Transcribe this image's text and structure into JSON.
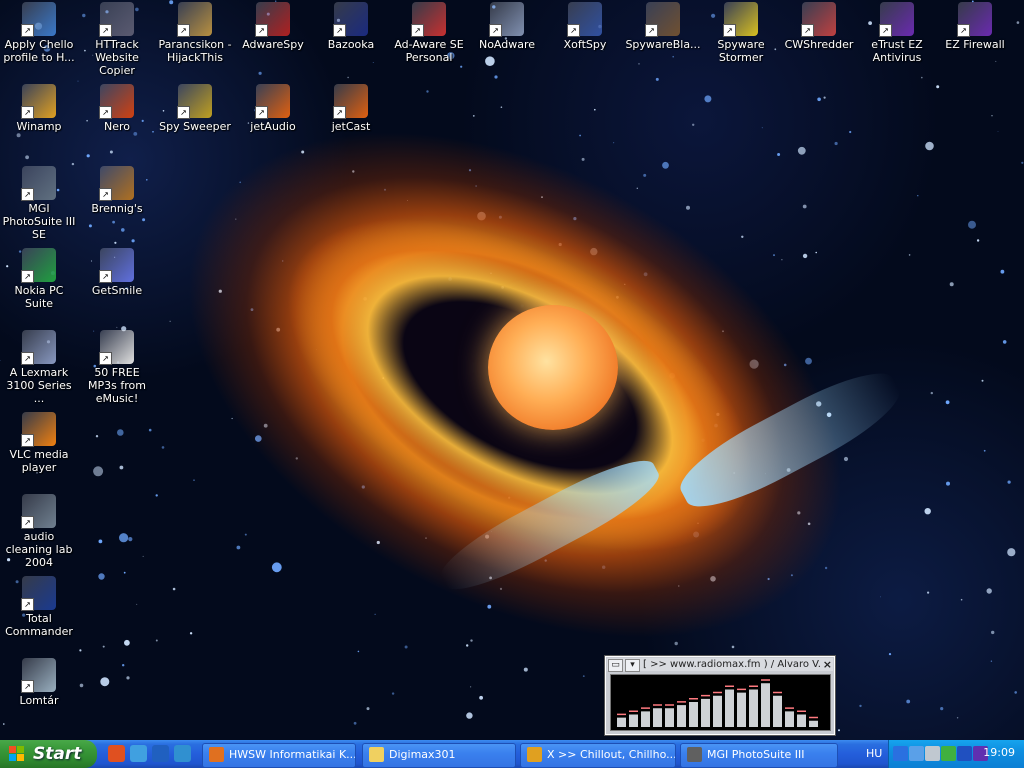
{
  "desktop": {
    "icons": [
      {
        "label": "Apply Chello profile to H...",
        "icon": "chello-profile-icon",
        "color": "#3a78c8"
      },
      {
        "label": "HTTrack Website Copier",
        "icon": "httrack-icon",
        "color": "#5a5a70"
      },
      {
        "label": "Parancsikon - HijackThis",
        "icon": "hijackthis-icon",
        "color": "#b89040"
      },
      {
        "label": "AdwareSpy",
        "icon": "adwarespy-icon",
        "color": "#b02020"
      },
      {
        "label": "Bazooka",
        "icon": "bazooka-icon",
        "color": "#1a2a80"
      },
      {
        "label": "Ad-Aware SE Personal",
        "icon": "adaware-icon",
        "color": "#c83030"
      },
      {
        "label": "NoAdware",
        "icon": "noadware-icon",
        "color": "#8090b0"
      },
      {
        "label": "XoftSpy",
        "icon": "xoftspy-icon",
        "color": "#3050a0"
      },
      {
        "label": "SpywareBla...",
        "icon": "spywareblaster-icon",
        "color": "#705030"
      },
      {
        "label": "Spyware Stormer",
        "icon": "spyware-stormer-icon",
        "color": "#d8c020"
      },
      {
        "label": "CWShredder",
        "icon": "cwshredder-icon",
        "color": "#c04040"
      },
      {
        "label": "eTrust EZ Antivirus",
        "icon": "etrust-ez-antivirus-icon",
        "color": "#6a2ab0"
      },
      {
        "label": "EZ Firewall",
        "icon": "ez-firewall-icon",
        "color": "#6a2ab0"
      },
      {
        "label": "Winamp",
        "icon": "winamp-icon",
        "color": "#e0a020"
      },
      {
        "label": "Nero",
        "icon": "nero-icon",
        "color": "#d04010"
      },
      {
        "label": "Spy Sweeper",
        "icon": "spy-sweeper-icon",
        "color": "#c0a020"
      },
      {
        "label": "jetAudio",
        "icon": "jetaudio-icon",
        "color": "#e06010"
      },
      {
        "label": "jetCast",
        "icon": "jetcast-icon",
        "color": "#e06010"
      },
      {
        "label": "MGI PhotoSuite III SE",
        "icon": "photosuite-icon",
        "color": "#607080"
      },
      {
        "label": "Brennig's",
        "icon": "brennigs-icon",
        "color": "#b07020"
      },
      {
        "label": "Nokia PC Suite",
        "icon": "nokia-pc-suite-icon",
        "color": "#20a040"
      },
      {
        "label": "GetSmile",
        "icon": "getsmile-icon",
        "color": "#6070e0"
      },
      {
        "label": "A Lexmark 3100 Series ...",
        "icon": "lexmark-icon",
        "color": "#8898c0"
      },
      {
        "label": "50 FREE MP3s from eMusic!",
        "icon": "emusic-icon",
        "color": "#e0e0e0"
      },
      {
        "label": "VLC media player",
        "icon": "vlc-cone-icon",
        "color": "#f08010"
      },
      {
        "label": "audio cleaning lab 2004",
        "icon": "audio-cleaning-lab-icon",
        "color": "#708090"
      },
      {
        "label": "Total Commander",
        "icon": "floppy-disk-icon",
        "color": "#1a3a90"
      },
      {
        "label": "Lomtár",
        "icon": "recycle-bin-icon",
        "color": "#9ab0c0"
      }
    ]
  },
  "winamp": {
    "title": "[ >> www.radiomax.fm ) / Alvaro V...",
    "close": "×",
    "spectrum": [
      3,
      4,
      5,
      6,
      6,
      7,
      8,
      9,
      10,
      12,
      11,
      12,
      14,
      10,
      5,
      4,
      2
    ]
  },
  "taskbar": {
    "start_label": "Start",
    "quick_launch": [
      "media-player-icon",
      "network-icon",
      "internet-explorer-icon",
      "desktop-icon"
    ],
    "tasks": [
      {
        "label": "HWSW Informatikai K...",
        "icon": "firefox-icon",
        "color": "#e07020"
      },
      {
        "label": "Digimax301",
        "icon": "folder-icon",
        "color": "#f0d060"
      },
      {
        "label": "X >> Chillout, Chillho...",
        "icon": "winamp-icon",
        "color": "#e0a020"
      },
      {
        "label": "MGI PhotoSuite III",
        "icon": "camera-icon",
        "color": "#606060"
      }
    ],
    "language": "HU",
    "tray_icons": [
      "chevron-left-icon",
      "network-tray-icon",
      "volume-icon",
      "meter-icon",
      "antivirus-icon",
      "ez-tray-icon"
    ],
    "clock": "19:09"
  }
}
